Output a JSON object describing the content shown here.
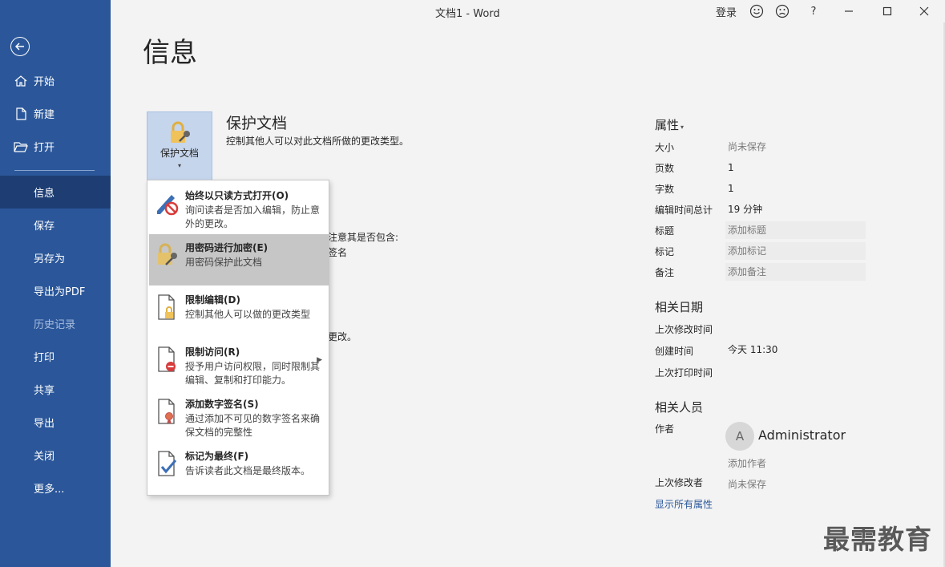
{
  "window": {
    "title": "文档1  -  Word",
    "signin": "登录",
    "help": "?"
  },
  "sidebar": {
    "items": [
      {
        "label": "开始",
        "icon": "home-icon"
      },
      {
        "label": "新建",
        "icon": "new-document-icon"
      },
      {
        "label": "打开",
        "icon": "open-folder-icon"
      },
      {
        "label": "信息",
        "active": true
      },
      {
        "label": "保存"
      },
      {
        "label": "另存为"
      },
      {
        "label": "导出为PDF"
      },
      {
        "label": "历史记录",
        "disabled": true
      },
      {
        "label": "打印"
      },
      {
        "label": "共享"
      },
      {
        "label": "导出"
      },
      {
        "label": "关闭"
      },
      {
        "label": "更多..."
      }
    ]
  },
  "main": {
    "title": "信息",
    "protect": {
      "tile_label": "保护文档",
      "heading": "保护文档",
      "description": "控制其他人可以对此文档所做的更改类型。"
    },
    "background_fragments": [
      "注意其是否包含:",
      "签名",
      "更改。"
    ]
  },
  "menu": {
    "items": [
      {
        "title": "始终以只读方式打开(O)",
        "description": "询问读者是否加入编辑，防止意外的更改。",
        "icon": "pencil-no-icon"
      },
      {
        "title": "用密码进行加密(E)",
        "description": "用密码保护此文档",
        "icon": "lock-key-icon",
        "highlighted": true
      },
      {
        "title": "限制编辑(D)",
        "description": "控制其他人可以做的更改类型",
        "icon": "document-lock-icon"
      },
      {
        "title": "限制访问(R)",
        "description": "授予用户访问权限，同时限制其编辑、复制和打印能力。",
        "icon": "document-restricted-icon",
        "has_submenu": true
      },
      {
        "title": "添加数字签名(S)",
        "description": "通过添加不可见的数字签名来确保文档的完整性",
        "icon": "document-ribbon-icon"
      },
      {
        "title": "标记为最终(F)",
        "description": "告诉读者此文档是最终版本。",
        "icon": "document-check-icon"
      }
    ]
  },
  "properties": {
    "heading": "属性",
    "rows": [
      {
        "label": "大小",
        "value": "尚未保存",
        "placeholder": true
      },
      {
        "label": "页数",
        "value": "1"
      },
      {
        "label": "字数",
        "value": "1"
      },
      {
        "label": "编辑时间总计",
        "value": "19 分钟"
      },
      {
        "label": "标题",
        "value": "添加标题",
        "placeholder": true
      },
      {
        "label": "标记",
        "value": "添加标记",
        "placeholder": true
      },
      {
        "label": "备注",
        "value": "添加备注",
        "placeholder": true
      }
    ],
    "dates_heading": "相关日期",
    "dates": [
      {
        "label": "上次修改时间",
        "value": ""
      },
      {
        "label": "创建时间",
        "value": "今天 11:30"
      },
      {
        "label": "上次打印时间",
        "value": ""
      }
    ],
    "people_heading": "相关人员",
    "author_label": "作者",
    "author_initial": "A",
    "author_name": "Administrator",
    "add_author": "添加作者",
    "last_modified_by_label": "上次修改者",
    "last_modified_by_value": "尚未保存",
    "show_all_link": "显示所有属性"
  },
  "watermark": "最需教育",
  "colors": {
    "sidebar": "#2b579a",
    "sidebar_active": "#1e3e73",
    "menu_hover": "#c6c6c6",
    "link": "#2b579a"
  }
}
